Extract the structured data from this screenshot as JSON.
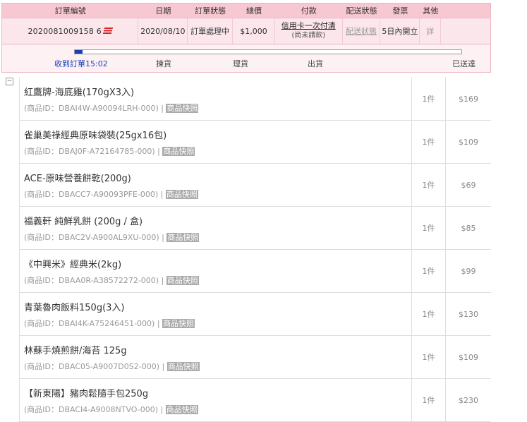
{
  "order": {
    "headers": [
      "訂單編號",
      "日期",
      "訂單狀態",
      "總價",
      "付款",
      "配送狀態",
      "發票",
      "其他"
    ],
    "number": "2020081009158 6",
    "date": "2020/08/10",
    "status": "訂單處理中",
    "total": "$1,000",
    "payment_link": "信用卡一次付清",
    "payment_sub": "(尚未請款)",
    "shipping_status": "配送狀態",
    "invoice": "5日內開立",
    "other": "詳"
  },
  "progress": {
    "fraction": 0.02,
    "stage_received": "收到訂單",
    "stage_received_time": "15:02",
    "stage_pick": "揀貨",
    "stage_pack": "理貨",
    "stage_ship": "出貨",
    "stage_done": "已送達"
  },
  "items": [
    {
      "name": "紅鷹牌-海底雞(170gX3入)",
      "id_label": "(商品ID：DBAI4W-A90094LRH-000)",
      "snapshot": "商品快照",
      "qty": "1件",
      "price": "$169"
    },
    {
      "name": "雀巢美祿經典原味袋裝(25gx16包)",
      "id_label": "(商品ID：DBAJ0F-A72164785-000)",
      "snapshot": "商品快照",
      "qty": "1件",
      "price": "$109"
    },
    {
      "name": "ACE-原味營養餅乾(200g)",
      "id_label": "(商品ID：DBACC7-A90093PFE-000)",
      "snapshot": "商品快照",
      "qty": "1件",
      "price": "$69"
    },
    {
      "name": "福義軒 純鮮乳餅 (200g / 盒)",
      "id_label": "(商品ID：DBAC2V-A900AL9XU-000)",
      "snapshot": "商品快照",
      "qty": "1件",
      "price": "$85"
    },
    {
      "name": "《中興米》經典米(2kg)",
      "id_label": "(商品ID：DBAA0R-A38572272-000)",
      "snapshot": "商品快照",
      "qty": "1件",
      "price": "$99"
    },
    {
      "name": "青葉魯肉飯料150g(3入)",
      "id_label": "(商品ID：DBAI4K-A75246451-000)",
      "snapshot": "商品快照",
      "qty": "1件",
      "price": "$130"
    },
    {
      "name": "林蘇手燒煎餅/海苔 125g",
      "id_label": "(商品ID：DBAC05-A9007D0S2-000)",
      "snapshot": "商品快照",
      "qty": "1件",
      "price": "$109"
    },
    {
      "name": "【新東陽】豬肉鬆隨手包250g",
      "id_label": "(商品ID：DBACI4-A9008NTVO-000)",
      "snapshot": "商品快照",
      "qty": "1件",
      "price": "$230"
    }
  ]
}
